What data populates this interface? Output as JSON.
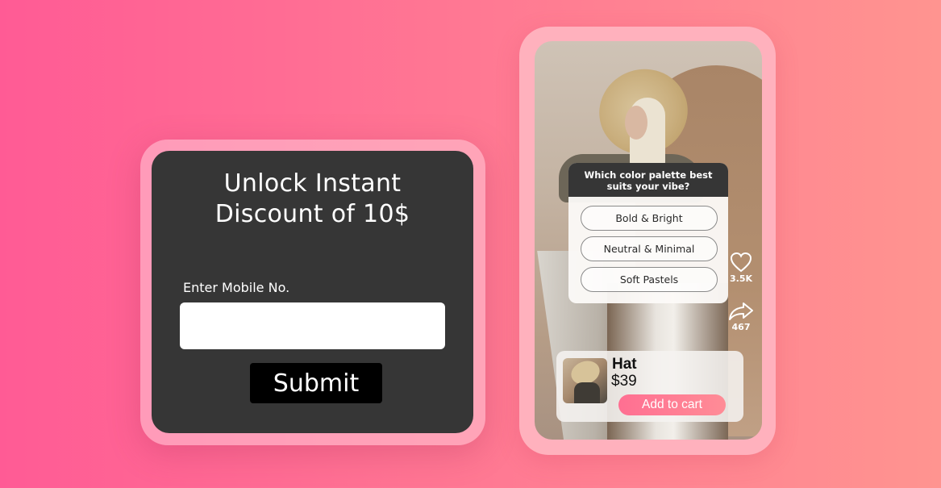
{
  "discount_card": {
    "title_line1": "Unlock Instant",
    "title_line2": "Discount of 10$",
    "mobile_label": "Enter Mobile No.",
    "mobile_value": "",
    "submit_label": "Submit"
  },
  "phone": {
    "poll": {
      "question_line1": "Which color palette best",
      "question_line2": "suits your vibe?",
      "options": [
        "Bold & Bright",
        "Neutral & Minimal",
        "Soft Pastels"
      ]
    },
    "actions": {
      "like_icon": "heart-icon",
      "like_count": "3.5K",
      "share_icon": "share-arrow-icon",
      "share_count": "467"
    },
    "product": {
      "name": "Hat",
      "price": "$39",
      "cta_label": "Add to cart"
    }
  },
  "colors": {
    "background_start": "#ff5b95",
    "background_end": "#ff9490",
    "card_dark": "#363636",
    "phone_frame": "#ffb1bd",
    "cta_pink": "#ff7a94"
  }
}
